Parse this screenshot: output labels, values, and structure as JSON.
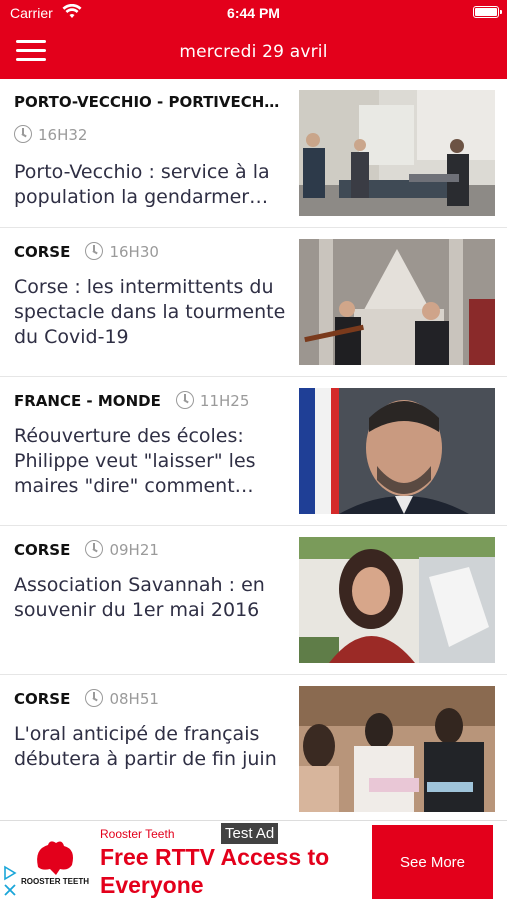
{
  "status_bar": {
    "carrier": "Carrier",
    "time": "6:44 PM"
  },
  "header": {
    "date": "mercredi 29 avril"
  },
  "articles": [
    {
      "category": "PORTO-VECCHIO - PORTIVECH…",
      "time": "16H32",
      "title": "Porto-Vecchio : service à la population la gendarmer…",
      "image": "gendarmes-room-photo"
    },
    {
      "category": "CORSE",
      "time": "16H30",
      "title": "Corse : les intermittents du spectacle dans la tourmente du Covid-19",
      "image": "musicians-church-photo"
    },
    {
      "category": "FRANCE - MONDE",
      "time": "11H25",
      "title": "Réouverture des écoles: Philippe veut \"laisser\" les maires \"dire\" comment…",
      "image": "portrait-man-flag-photo"
    },
    {
      "category": "CORSE",
      "time": "09H21",
      "title": "Association Savannah : en souvenir du 1er mai 2016",
      "image": "portrait-woman-photo"
    },
    {
      "category": "CORSE",
      "time": "08H51",
      "title": "L'oral anticipé de français débutera à partir de fin juin",
      "image": "students-reading-photo"
    }
  ],
  "ad": {
    "advertiser": "Rooster Teeth",
    "headline": "Free RTTV Access to Everyone",
    "test_label": "Test Ad",
    "cta": "See More",
    "logo_text": "ROOSTER TEETH"
  },
  "colors": {
    "brand_red": "#e3001b",
    "meta_gray": "#9a9a9a"
  }
}
